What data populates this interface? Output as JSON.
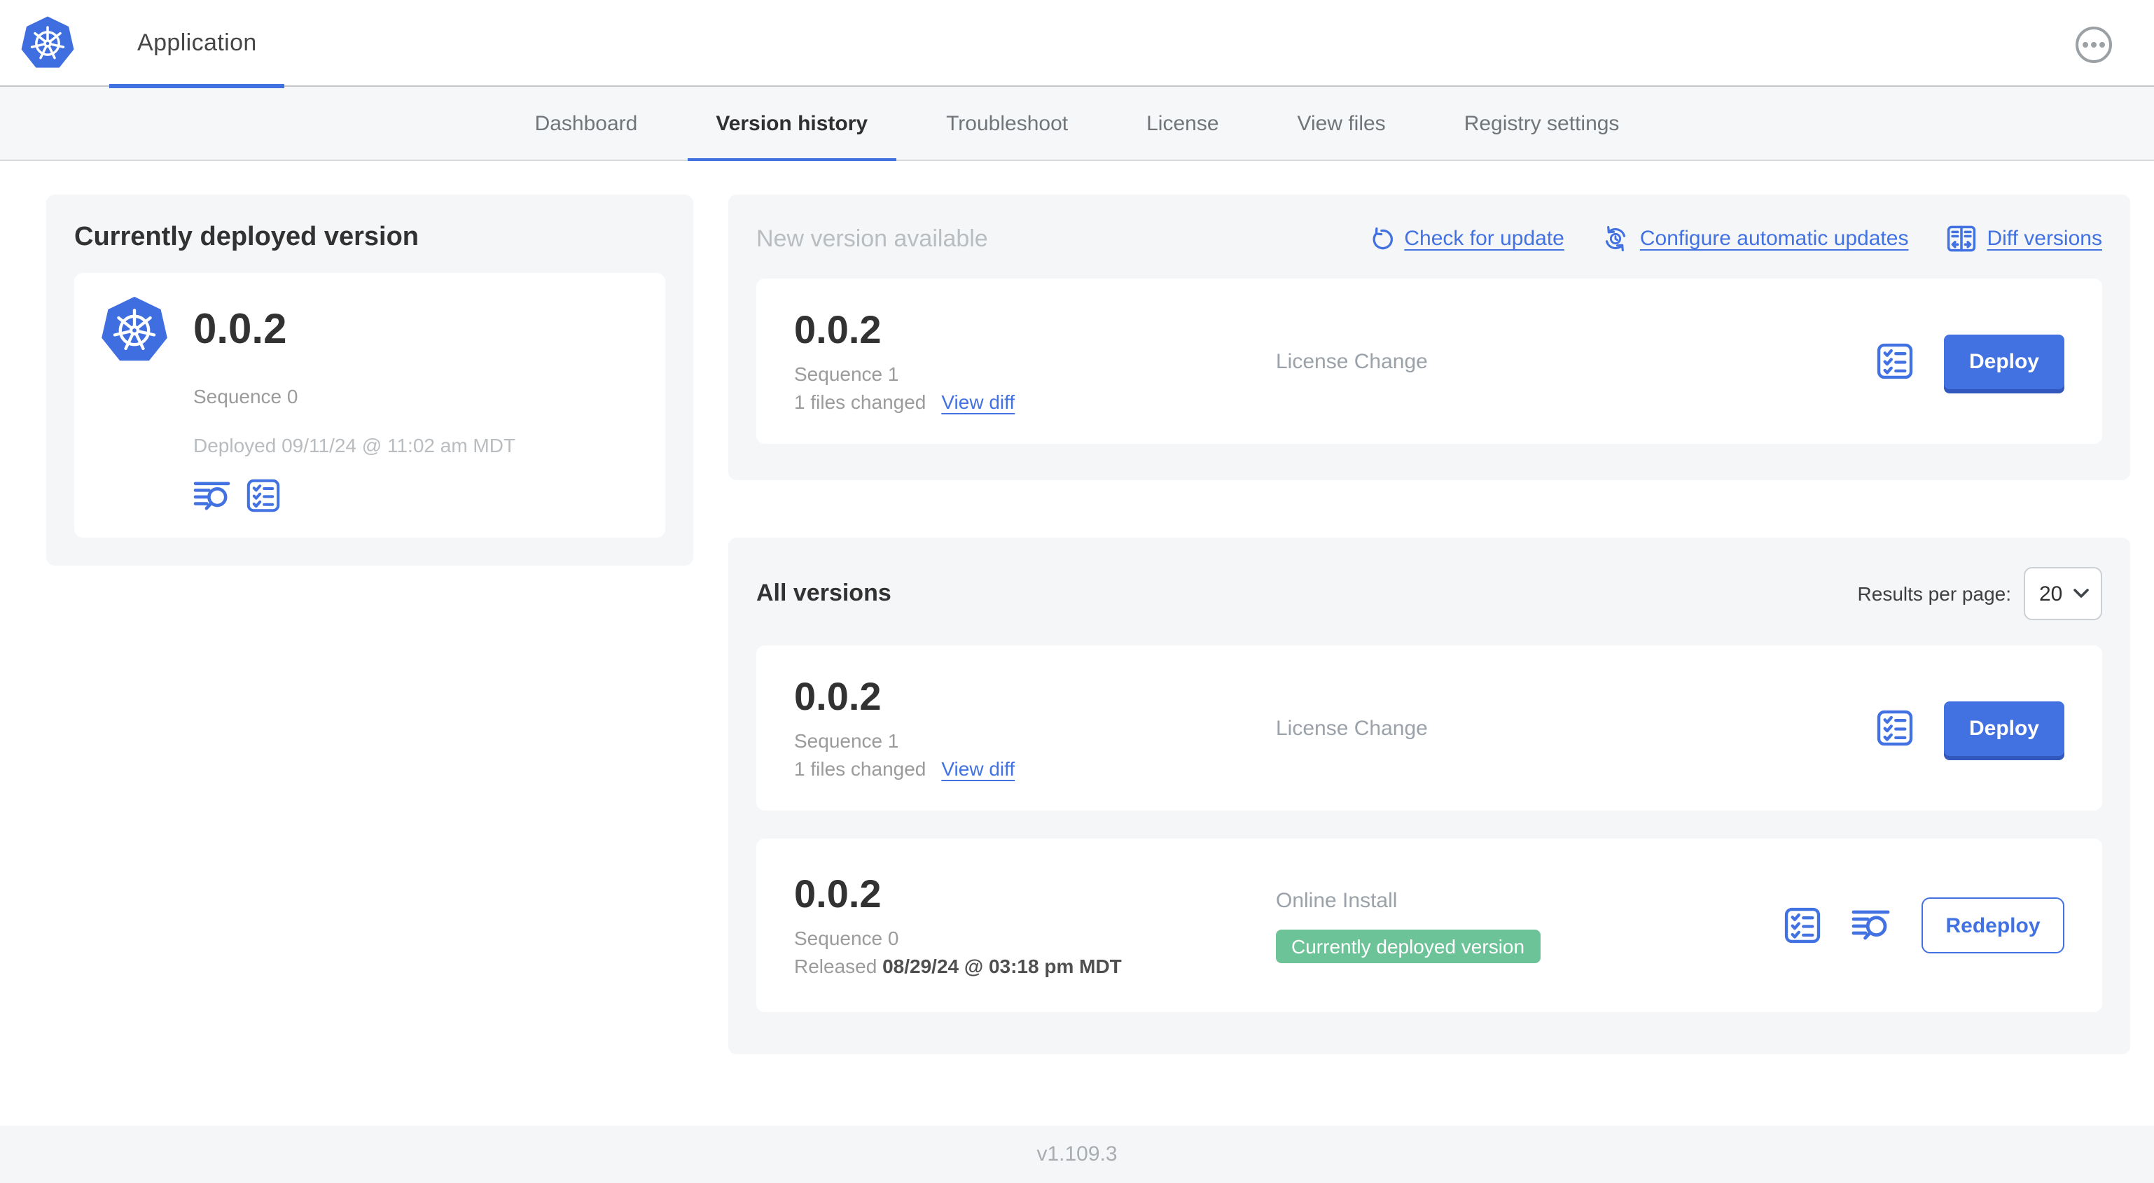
{
  "colors": {
    "accent_blue": "#4271e2",
    "badge_green": "#6cc398",
    "k8s_blue": "#3f6ee0"
  },
  "header": {
    "app_title": "Application"
  },
  "nav_tabs": [
    {
      "label": "Dashboard",
      "active": false
    },
    {
      "label": "Version history",
      "active": true
    },
    {
      "label": "Troubleshoot",
      "active": false
    },
    {
      "label": "License",
      "active": false
    },
    {
      "label": "View files",
      "active": false
    },
    {
      "label": "Registry settings",
      "active": false
    }
  ],
  "currently_deployed": {
    "heading": "Currently deployed version",
    "version": "0.0.2",
    "sequence": "Sequence 0",
    "deployed_timestamp": "Deployed 09/11/24 @ 11:02 am MDT"
  },
  "new_version": {
    "heading": "New version available",
    "actions": [
      {
        "icon": "refresh-icon",
        "label": "Check for update"
      },
      {
        "icon": "schedule-update-icon",
        "label": "Configure automatic updates"
      },
      {
        "icon": "diff-icon",
        "label": "Diff versions"
      }
    ],
    "card": {
      "version": "0.0.2",
      "sequence": "Sequence 1",
      "files_changed": "1 files changed",
      "view_diff_label": "View diff",
      "source": "License Change",
      "deploy_label": "Deploy"
    }
  },
  "all_versions": {
    "heading": "All versions",
    "results_per_page_label": "Results per page:",
    "results_per_page_value": "20",
    "rows": [
      {
        "version": "0.0.2",
        "sequence": "Sequence 1",
        "files_changed": "1 files changed",
        "view_diff_label": "View diff",
        "source": "License Change",
        "action_label": "Deploy"
      },
      {
        "version": "0.0.2",
        "sequence": "Sequence 0",
        "released_label": "Released",
        "released_timestamp": "08/29/24 @ 03:18 pm MDT",
        "source": "Online Install",
        "status_badge": "Currently deployed version",
        "action_label": "Redeploy"
      }
    ]
  },
  "footer": {
    "app_version": "v1.109.3"
  }
}
